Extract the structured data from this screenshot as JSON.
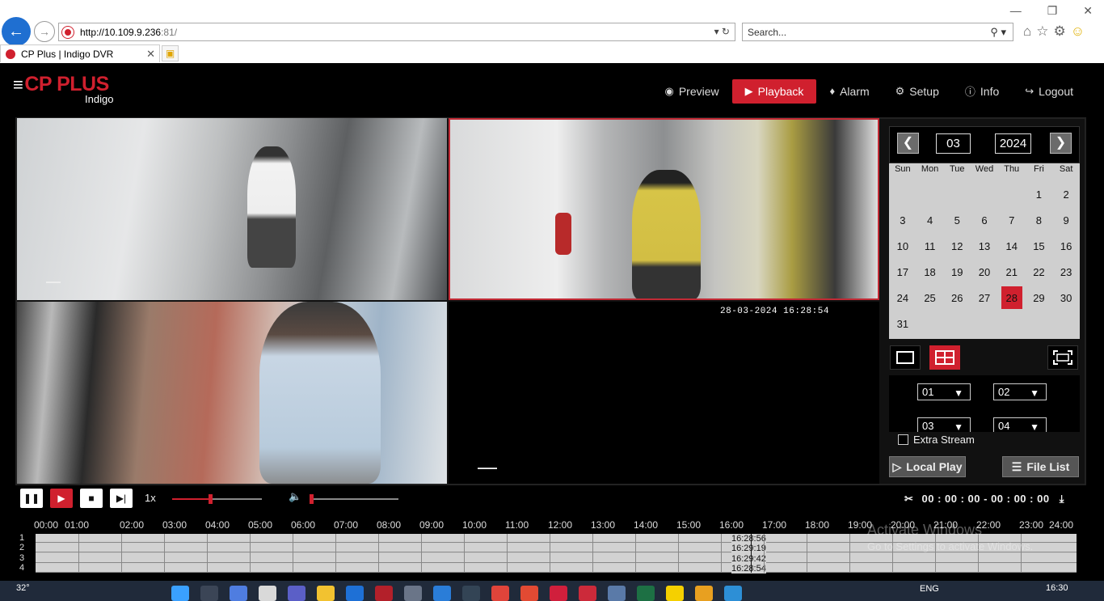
{
  "browser": {
    "url_host": "http://10.109.9.236",
    "url_port": ":81/",
    "search_placeholder": "Search...",
    "tab_title": "CP Plus | Indigo DVR"
  },
  "app": {
    "logo": "CP PLUS",
    "logo_sub": "Indigo",
    "nav": {
      "preview": "Preview",
      "playback": "Playback",
      "alarm": "Alarm",
      "setup": "Setup",
      "info": "Info",
      "logout": "Logout"
    }
  },
  "cameras": {
    "cam4_timestamp": "28-03-2024 16:28:54"
  },
  "calendar": {
    "month": "03",
    "year": "2024",
    "dow": [
      "Sun",
      "Mon",
      "Tue",
      "Wed",
      "Thu",
      "Fri",
      "Sat"
    ],
    "leading_blanks": 5,
    "days": [
      1,
      2,
      3,
      4,
      5,
      6,
      7,
      8,
      9,
      10,
      11,
      12,
      13,
      14,
      15,
      16,
      17,
      18,
      19,
      20,
      21,
      22,
      23,
      24,
      25,
      26,
      27,
      28,
      29,
      30,
      31
    ],
    "selected_day": 28
  },
  "channels": {
    "ch1": "01",
    "ch2": "02",
    "ch3": "03",
    "ch4": "04"
  },
  "extra_stream_label": "Extra Stream",
  "local_play_label": "Local Play",
  "file_list_label": "File List",
  "playback": {
    "speed": "1x",
    "progress": 0.42,
    "volume": 0.0,
    "clip_time": "00 : 00 : 00 - 00 : 00 : 00"
  },
  "timeline": {
    "hours": [
      "00:00",
      "01:00",
      "02:00",
      "03:00",
      "04:00",
      "05:00",
      "06:00",
      "07:00",
      "08:00",
      "09:00",
      "10:00",
      "11:00",
      "12:00",
      "13:00",
      "14:00",
      "15:00",
      "16:00",
      "17:00",
      "18:00",
      "19:00",
      "20:00",
      "21:00",
      "22:00",
      "23:00",
      "24:00"
    ],
    "rows": [
      "1",
      "2",
      "3",
      "4"
    ],
    "row_times": [
      "16:28:56",
      "16:29:19",
      "16:29:42",
      "16:28:54"
    ]
  },
  "watermark": {
    "line1": "Activate Windows",
    "line2": "Go to Settings to activate Windows."
  },
  "taskbar": {
    "weather": "32°",
    "lang": "ENG",
    "time": "16:30"
  }
}
